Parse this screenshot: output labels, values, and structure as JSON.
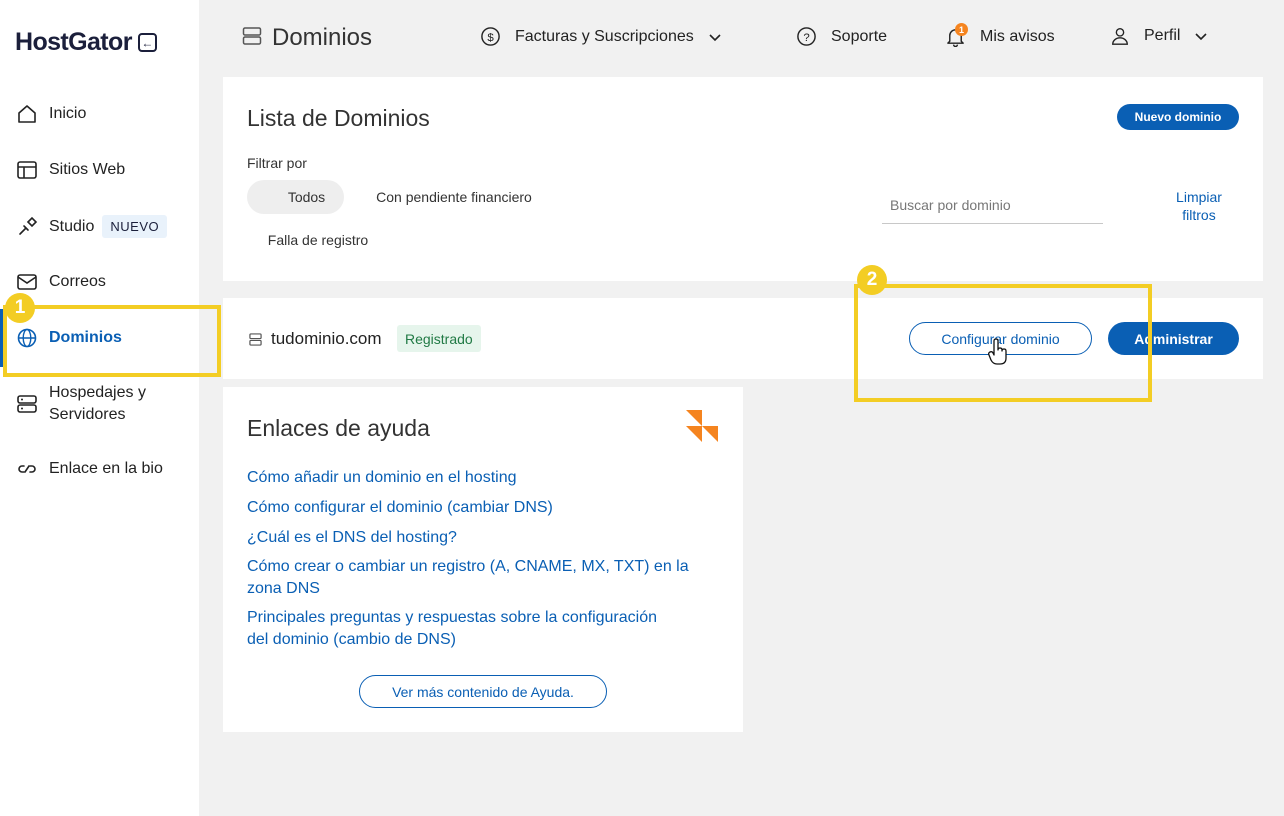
{
  "brand": {
    "name": "HostGator"
  },
  "sidebar": {
    "items": [
      {
        "label": "Inicio",
        "icon": "home-icon"
      },
      {
        "label": "Sitios Web",
        "icon": "layout-icon"
      },
      {
        "label": "Studio",
        "icon": "brush-icon",
        "badge": "NUEVO"
      },
      {
        "label": "Correos",
        "icon": "mail-icon"
      },
      {
        "label": "Dominios",
        "icon": "globe-icon",
        "active": true
      },
      {
        "label": "Hospedajes y Servidores",
        "line1": "Hospedajes y",
        "line2": "Servidores",
        "icon": "server-icon"
      },
      {
        "label": "Enlace en la bio",
        "icon": "link-icon"
      }
    ]
  },
  "header": {
    "title": "Dominios",
    "billing": "Facturas y Suscripciones",
    "support": "Soporte",
    "notices": "Mis avisos",
    "notices_count": "1",
    "profile": "Perfil"
  },
  "domain_list": {
    "title": "Lista de Dominios",
    "new_button": "Nuevo dominio",
    "filter_label": "Filtrar por",
    "filters": [
      "Todos",
      "Con pendiente financiero",
      "Falla de registro"
    ],
    "selected_filter": "Todos",
    "search_placeholder": "Buscar por dominio",
    "clear_line1": "Limpiar",
    "clear_line2": "filtros"
  },
  "domain_row": {
    "domain": "tudominio.com",
    "status": "Registrado",
    "configure_button": "Configurar dominio",
    "manage_button": "Administrar"
  },
  "help": {
    "title": "Enlaces de ayuda",
    "links": [
      {
        "line1": "Cómo añadir un dominio en el hosting",
        "line2": ""
      },
      {
        "line1": "Cómo configurar el dominio (cambiar DNS)",
        "line2": ""
      },
      {
        "line1": "¿Cuál es el DNS del hosting?",
        "line2": ""
      },
      {
        "line1": "Cómo crear o cambiar un registro (A, CNAME, MX, TXT) en la",
        "line2": "zona DNS"
      },
      {
        "line1": "Principales preguntas y respuestas sobre la configuración",
        "line2": "del dominio (cambio de DNS)"
      }
    ],
    "more_button": "Ver más contenido de Ayuda."
  },
  "annotations": {
    "step1": "1",
    "step2": "2"
  },
  "colors": {
    "accent": "#0a5fb4",
    "highlight": "#f3cd24",
    "notification": "#f5841f",
    "status_green": "#217a45"
  }
}
